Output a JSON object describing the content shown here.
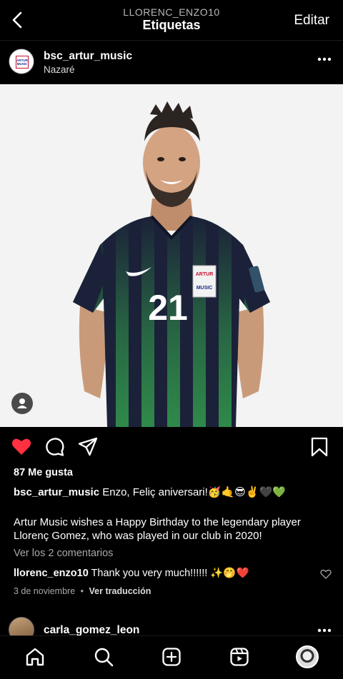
{
  "header": {
    "username": "LLORENC_ENZO10",
    "title": "Etiquetas",
    "edit_label": "Editar"
  },
  "post": {
    "author": "bsc_artur_music",
    "location": "Nazaré",
    "avatar_logo": "ARTUR MUSIC",
    "photo": {
      "jersey_number": "21",
      "sponsor_badge": "ARTUR MUSIC",
      "jersey_colors": [
        "#1b2138",
        "#2f8a4a"
      ],
      "background": "#f3f3f3"
    },
    "liked": true,
    "likes_text": "87 Me gusta",
    "caption_author": "bsc_artur_music",
    "caption_text": "Enzo, Feliç aniversari!🥳🤙😎✌️🖤💚",
    "caption_body": "Artur Music wishes a Happy Birthday to the legendary player Llorenç Gomez, who was played in our club in 2020!",
    "view_comments": "Ver los 2 comentarios",
    "comment": {
      "author": "llorenc_enzo10",
      "text": "Thank you very much!!!!!! ✨🤭❤️"
    },
    "date": "3 de noviembre",
    "separator": "•",
    "translate_label": "Ver traducción"
  },
  "next_post": {
    "author": "carla_gomez_leon"
  },
  "icons": {
    "back": "chevron-left-icon",
    "more": "more-horizontal-icon",
    "like": "heart-filled-icon",
    "comment": "comment-icon",
    "share": "send-icon",
    "save": "bookmark-icon",
    "tabs": [
      "home-icon",
      "search-icon",
      "add-icon",
      "reels-icon",
      "profile-icon"
    ]
  },
  "colors": {
    "like_red": "#ff3040",
    "background": "#000000",
    "muted": "#a8a8a8"
  }
}
